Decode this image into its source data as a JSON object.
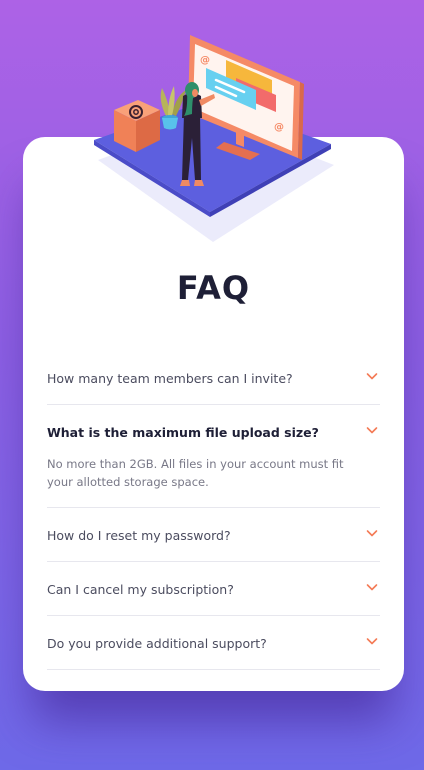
{
  "colors": {
    "background_top": "#ad62e6",
    "background_bottom": "#6e69e8",
    "card": "#ffffff",
    "title": "#1e1f36",
    "question": "#4b4c5f",
    "answer": "#787887",
    "accent": "#f47b56",
    "divider": "#e7e7ee"
  },
  "illustration": {
    "name": "woman-at-online-monitor-illustration",
    "at_symbol": "@"
  },
  "faq": {
    "title": "FAQ",
    "items": [
      {
        "question": "How many team members can I invite?",
        "answer": "",
        "open": false
      },
      {
        "question": "What is the maximum file upload size?",
        "answer": "No more than 2GB. All files in your account must fit your allotted storage space.",
        "open": true
      },
      {
        "question": "How do I reset my password?",
        "answer": "",
        "open": false
      },
      {
        "question": "Can I cancel my subscription?",
        "answer": "",
        "open": false
      },
      {
        "question": "Do you provide additional support?",
        "answer": "",
        "open": false
      }
    ],
    "chevron_icon": "chevron-down-icon"
  }
}
